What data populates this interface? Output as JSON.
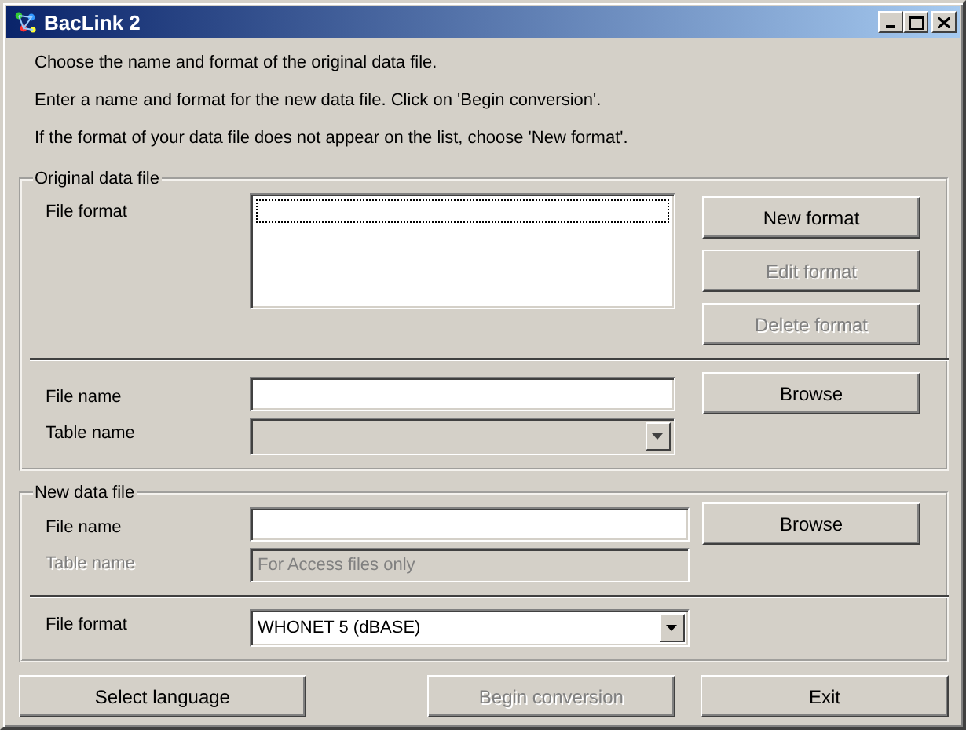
{
  "window": {
    "title": "BacLink 2"
  },
  "instructions": [
    "Choose the name and format of the original data file.",
    "Enter a name and format for the new data file.  Click on 'Begin conversion'.",
    "If the format of your data file does not appear on the list, choose 'New format'."
  ],
  "original_file": {
    "title": "Original data file",
    "file_format": {
      "label": "File format"
    },
    "format_buttons": [
      {
        "label": "New format",
        "disabled": false
      },
      {
        "label": "Edit format",
        "disabled": true
      },
      {
        "label": "Delete format",
        "disabled": true
      }
    ],
    "file_name": {
      "label": "File name"
    },
    "browse": {
      "label": "Browse",
      "disabled": false
    },
    "table_name": {
      "label": "Table name",
      "disabled": true
    }
  },
  "new_file": {
    "title": "New data file",
    "file_name": {
      "label": "File name"
    },
    "browse": {
      "label": "Browse",
      "disabled": false
    },
    "table_name": {
      "label": "Table name",
      "value": "For Access files only",
      "disabled": true
    },
    "file_format": {
      "label": "File format",
      "value": "WHONET 5 (dBASE)",
      "disabled": false
    }
  },
  "buttons": [
    {
      "label": "Select language",
      "disabled": false
    },
    {
      "label": "Begin conversion",
      "disabled": true
    },
    {
      "label": "Exit",
      "disabled": false
    }
  ]
}
